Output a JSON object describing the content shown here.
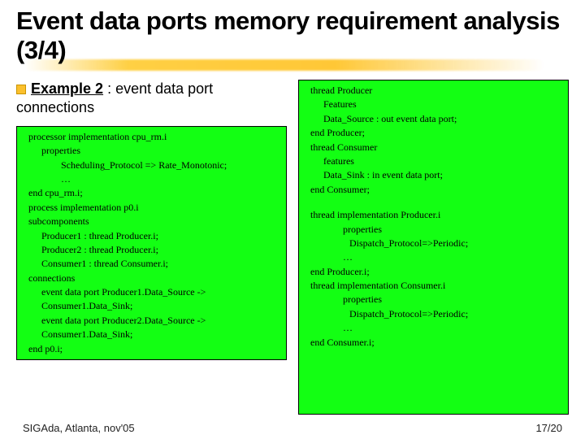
{
  "slide": {
    "title": "Event data ports memory requirement analysis (3/4)",
    "bullet_label": "Example 2",
    "bullet_rest": " : event data port connections",
    "left_code": [
      {
        "cls": "ind1",
        "t": "processor implementation cpu_rm.i"
      },
      {
        "cls": "ind2",
        "t": "properties"
      },
      {
        "cls": "ind3",
        "t": "Scheduling_Protocol => Rate_Monotonic;"
      },
      {
        "cls": "ind3",
        "t": "…"
      },
      {
        "cls": "ind1",
        "t": "end cpu_rm.i;"
      },
      {
        "cls": "ind1",
        "t": "process implementation p0.i"
      },
      {
        "cls": "ind1",
        "t": "subcomponents"
      },
      {
        "cls": "ind2",
        "t": "Producer1 : thread Producer.i;"
      },
      {
        "cls": "ind2",
        "t": "Producer2 : thread Producer.i;"
      },
      {
        "cls": "ind2",
        "t": "Consumer1 : thread Consumer.i;"
      },
      {
        "cls": "ind1",
        "t": "connections"
      },
      {
        "cls": "ind2",
        "t": "event data port Producer1.Data_Source -> Consumer1.Data_Sink;"
      },
      {
        "cls": "ind2",
        "t": "event data port Producer2.Data_Source -> Consumer1.Data_Sink;"
      },
      {
        "cls": "ind1",
        "t": "end p0.i;"
      }
    ],
    "right_code": [
      {
        "cls": "ind1",
        "t": "thread Producer"
      },
      {
        "cls": "ind2",
        "t": "Features"
      },
      {
        "cls": "ind2",
        "t": "  Data_Source : out event data port;"
      },
      {
        "cls": "ind1",
        "t": "end Producer;"
      },
      {
        "cls": "ind1",
        "t": "thread Consumer"
      },
      {
        "cls": "ind2",
        "t": "features"
      },
      {
        "cls": "ind2",
        "t": "  Data_Sink : in event data port;"
      },
      {
        "cls": "ind1",
        "t": "end Consumer;"
      },
      {
        "cls": "blank",
        "t": ""
      },
      {
        "cls": "ind1",
        "t": "thread implementation Producer.i"
      },
      {
        "cls": "ind3",
        "t": "properties"
      },
      {
        "cls": "ind4",
        "t": "Dispatch_Protocol=>Periodic;"
      },
      {
        "cls": "ind3",
        "t": "…"
      },
      {
        "cls": "ind1",
        "t": "end Producer.i;"
      },
      {
        "cls": "ind1",
        "t": "thread implementation Consumer.i"
      },
      {
        "cls": "ind3",
        "t": "properties"
      },
      {
        "cls": "ind4",
        "t": "Dispatch_Protocol=>Periodic;"
      },
      {
        "cls": "ind3",
        "t": "…"
      },
      {
        "cls": "ind1",
        "t": "end Consumer.i;"
      }
    ],
    "footer_left": "SIGAda, Atlanta, nov'05",
    "footer_right": "17/20"
  }
}
